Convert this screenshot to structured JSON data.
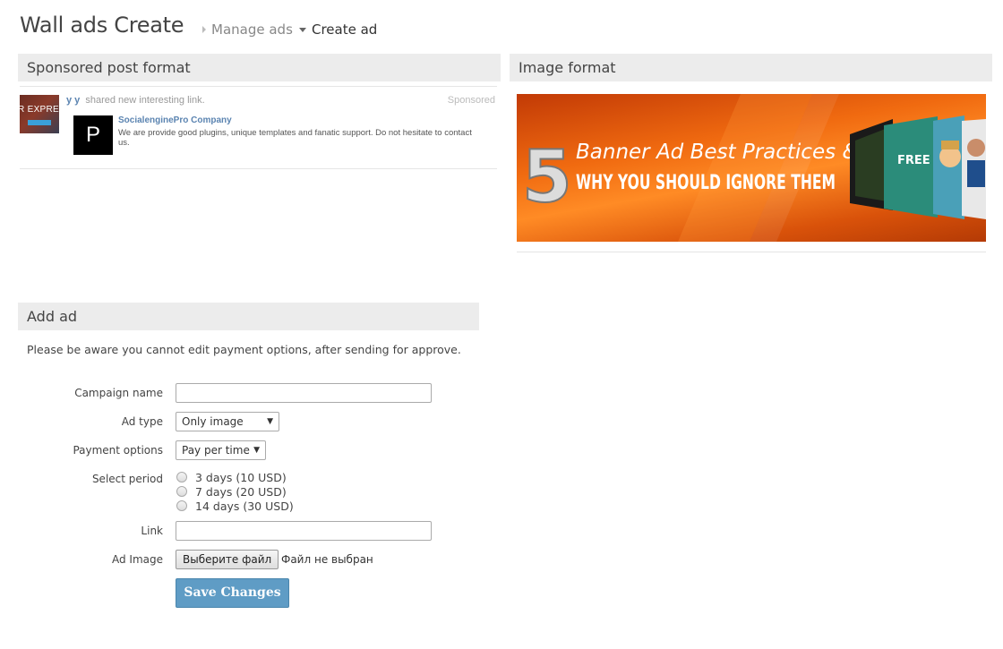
{
  "page": {
    "title": "Wall ads Create"
  },
  "nav": {
    "manage_ads": "Manage ads",
    "create_ad": "Create ad"
  },
  "sponsored_section": {
    "heading": "Sponsored post format",
    "thumb_text": "R EXPRES",
    "user": "y y",
    "action": "shared new interesting link.",
    "sponsored_label": "Sponsored",
    "logo_letter": "P",
    "company": "SocialenginePro Company",
    "description": "We are provide good plugins, unique templates and fanatic support. Do not hesitate to contact us."
  },
  "image_section": {
    "heading": "Image format",
    "banner_number": "5",
    "banner_line1": "Banner Ad Best Practices &",
    "banner_line2": "WHY YOU SHOULD IGNORE THEM",
    "banner_free": "FREE"
  },
  "add_ad": {
    "heading": "Add ad",
    "notice": "Please be aware you cannot edit payment options, after sending for approve.",
    "campaign_label": "Campaign name",
    "campaign_value": "",
    "ad_type_label": "Ad type",
    "ad_type_value": "Only image",
    "payment_label": "Payment options",
    "payment_value": "Pay per time",
    "period_label": "Select period",
    "period_options": [
      "3 days (10 USD)",
      "7 days (20 USD)",
      "14 days (30 USD)"
    ],
    "link_label": "Link",
    "link_value": "",
    "image_label": "Ad Image",
    "file_button": "Выберите файл",
    "file_status": "Файл не выбран",
    "save_button": "Save Changes"
  },
  "colors": {
    "link_blue": "#5b84b1",
    "button_blue": "#5f9cc5",
    "section_bg": "#ececec",
    "banner_orange": "#f06a10"
  }
}
